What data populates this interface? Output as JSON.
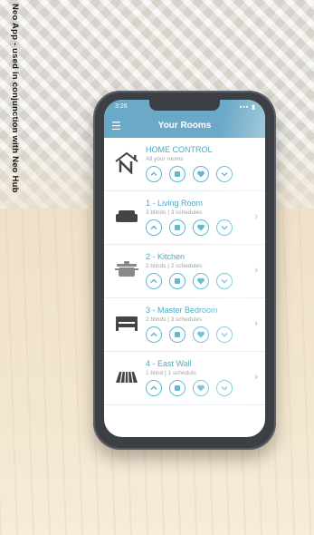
{
  "caption": "Neo App - used in conjunction with Neo Hub",
  "status_bar": {
    "time": "3:26"
  },
  "header": {
    "title": "Your Rooms"
  },
  "rooms": [
    {
      "name": "HOME CONTROL",
      "subtitle": "All your rooms",
      "icon": "neo-logo-icon",
      "has_chevron": false
    },
    {
      "name": "1 - Living Room",
      "subtitle": "3 blinds | 3 schedules",
      "icon": "sofa-icon",
      "has_chevron": true
    },
    {
      "name": "2 - Kitchen",
      "subtitle": "2 blinds | 2 schedules",
      "icon": "pot-icon",
      "has_chevron": true
    },
    {
      "name": "3 - Master Bedroom",
      "subtitle": "2 blinds | 3 schedules",
      "icon": "bed-icon",
      "has_chevron": true
    },
    {
      "name": "4 - East Wall",
      "subtitle": "1 blind | 1 schedule",
      "icon": "awning-icon",
      "has_chevron": true
    }
  ],
  "colors": {
    "accent": "#6ba9c8",
    "button": "#5fb9d3",
    "room_name": "#4aa9c9"
  },
  "icons": {
    "menu": "menu-icon",
    "buttons": [
      "up-icon",
      "stop-icon",
      "favourite-icon",
      "down-icon"
    ],
    "chevron": "chevron-right-icon"
  }
}
